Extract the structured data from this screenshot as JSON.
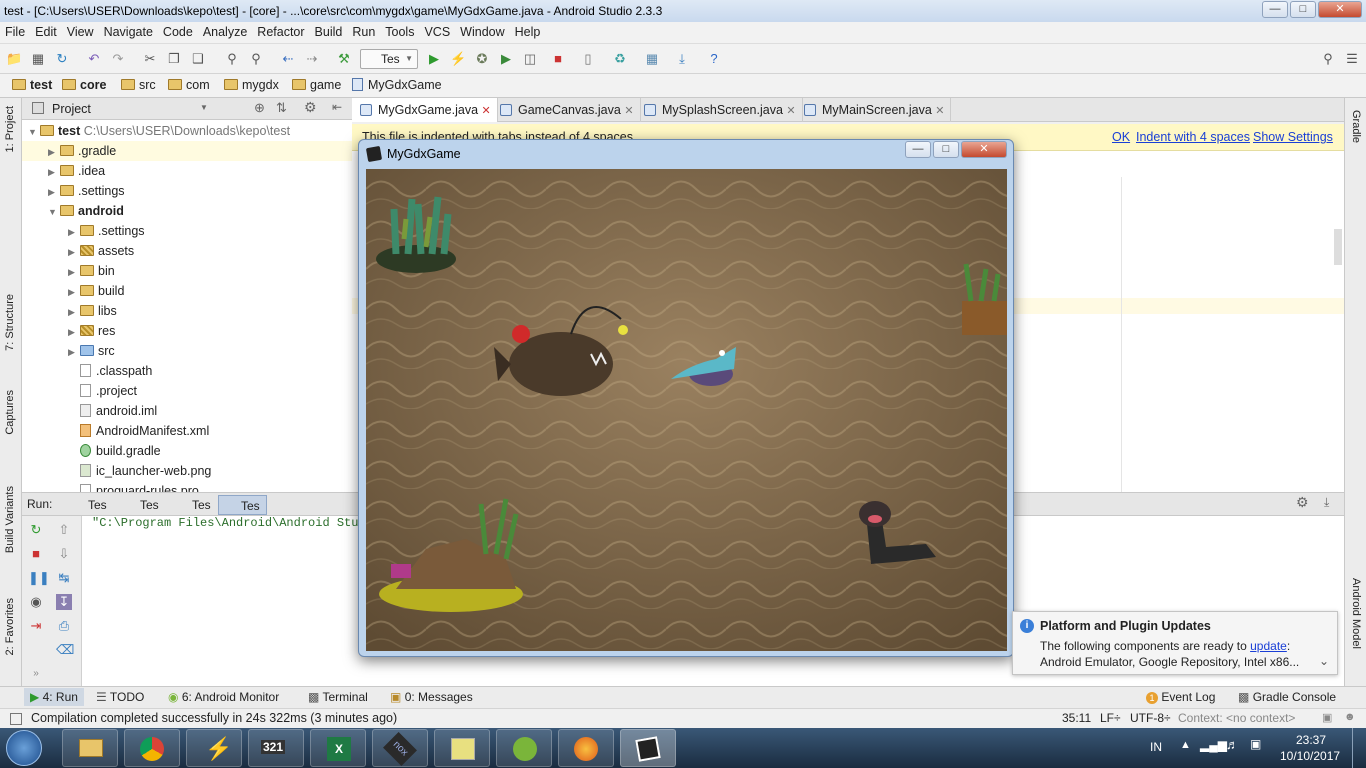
{
  "window": {
    "title": "test - [C:\\Users\\USER\\Downloads\\kepo\\test] - [core] - ...\\core\\src\\com\\mygdx\\game\\MyGdxGame.java - Android Studio 2.3.3"
  },
  "menu": [
    "File",
    "Edit",
    "View",
    "Navigate",
    "Code",
    "Analyze",
    "Refactor",
    "Build",
    "Run",
    "Tools",
    "VCS",
    "Window",
    "Help"
  ],
  "toolbar": {
    "run_config": "Tes"
  },
  "breadcrumb": [
    "test",
    "core",
    "src",
    "com",
    "mygdx",
    "game",
    "MyGdxGame"
  ],
  "left_tabs": {
    "project": "1: Project",
    "structure": "7: Structure",
    "captures": "Captures",
    "build_variants": "Build Variants",
    "favorites": "2: Favorites"
  },
  "right_tabs": {
    "gradle": "Gradle",
    "android_model": "Android Model"
  },
  "project": {
    "header": "Project",
    "root_label": "test",
    "root_path": "C:\\Users\\USER\\Downloads\\kepo\\test",
    "items": [
      ".gradle",
      ".idea",
      ".settings",
      "android",
      ".settings",
      "assets",
      "bin",
      "build",
      "libs",
      "res",
      "src",
      ".classpath",
      ".project",
      "android.iml",
      "AndroidManifest.xml",
      "build.gradle",
      "ic_launcher-web.png",
      "proguard-rules.pro"
    ]
  },
  "editor_tabs": [
    "MyGdxGame.java",
    "GameCanvas.java",
    "MySplashScreen.java",
    "MyMainScreen.java"
  ],
  "notice": {
    "text": "This file is indented with tabs instead of 4 spaces",
    "ok": "OK",
    "indent": "Indent with 4 spaces",
    "settings": "Show Settings"
  },
  "run": {
    "label": "Run:",
    "tabs": [
      "Tes",
      "Tes",
      "Tes",
      "Tes"
    ],
    "console": "\"C:\\Program Files\\Android\\Android Studio\\jre\\bin\\java\""
  },
  "game": {
    "title": "MyGdxGame"
  },
  "notification": {
    "title": "Platform and Plugin Updates",
    "text_prefix": "The following components are ready to ",
    "link": "update",
    "text_suffix": ":",
    "line2": "Android Emulator, Google Repository, Intel x86..."
  },
  "bottom_tabs": {
    "run": "4: Run",
    "todo": "TODO",
    "monitor": "6: Android Monitor",
    "terminal": "Terminal",
    "messages": "0: Messages",
    "event_log": "Event Log",
    "event_count": "1",
    "gradle_console": "Gradle Console"
  },
  "status": {
    "message": "Compilation completed successfully in 24s 322ms (3 minutes ago)",
    "position": "35:11",
    "lf": "LF÷",
    "encoding": "UTF-8÷",
    "context": "Context: <no context>"
  },
  "taskbar": {
    "lang": "IN",
    "time": "23:37",
    "date": "10/10/2017"
  }
}
